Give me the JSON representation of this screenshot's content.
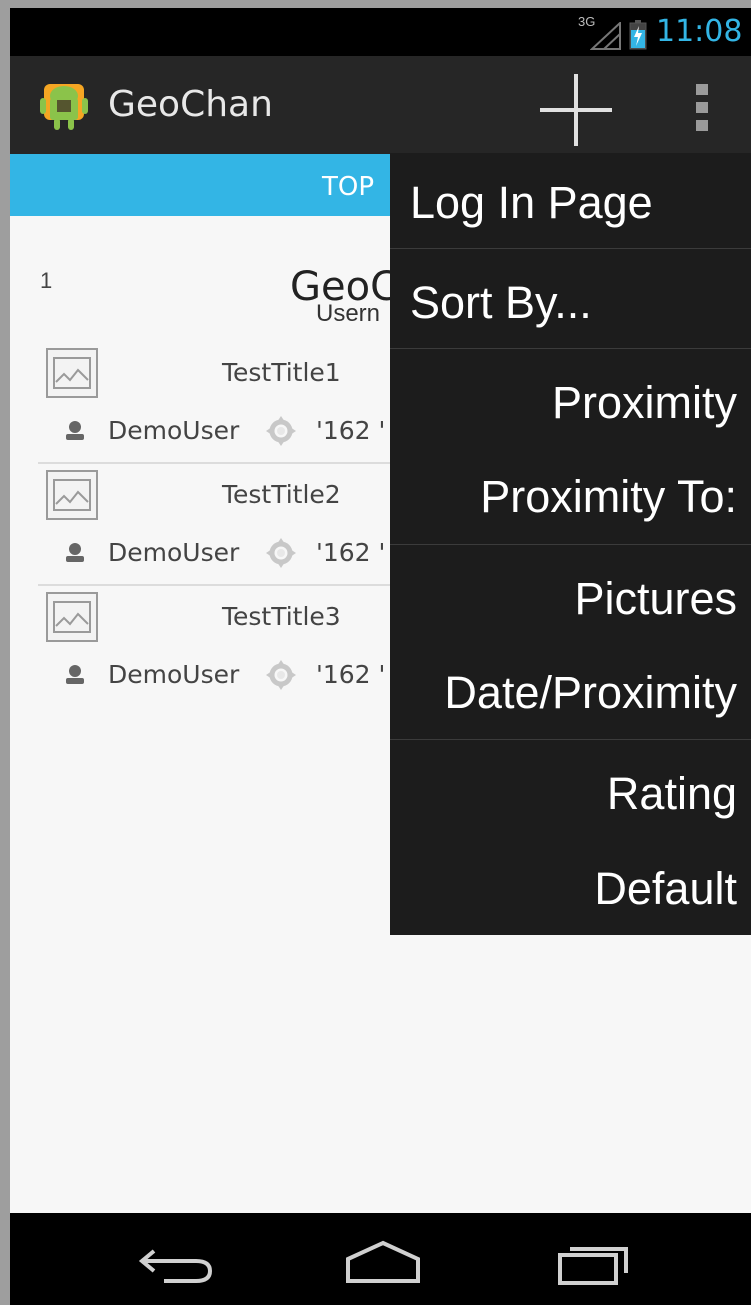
{
  "status_bar": {
    "network": "3G",
    "time": "11:08"
  },
  "action_bar": {
    "title": "GeoChan",
    "add_icon": "plus-icon",
    "overflow_icon": "overflow-menu-icon"
  },
  "tab": {
    "label": "TOP"
  },
  "list": {
    "rank": "1",
    "title": "GeoC",
    "subtitle": "Usern"
  },
  "posts": [
    {
      "title": "TestTitle1",
      "user": "DemoUser",
      "coord": "'162 '"
    },
    {
      "title": "TestTitle2",
      "user": "DemoUser",
      "coord": "'162 '"
    },
    {
      "title": "TestTitle3",
      "user": "DemoUser",
      "coord": "'162 '"
    }
  ],
  "menu": {
    "items": [
      {
        "label": "Log In Page"
      },
      {
        "label": "Sort By..."
      },
      {
        "label": "Proximity"
      },
      {
        "label": "Proximity To:"
      },
      {
        "label": "Pictures"
      },
      {
        "label": "Date/Proximity"
      },
      {
        "label": "Rating"
      },
      {
        "label": "Default"
      }
    ]
  },
  "colors": {
    "accent": "#33b5e5",
    "action_bar": "#262626",
    "menu_bg": "#1c1c1c"
  }
}
